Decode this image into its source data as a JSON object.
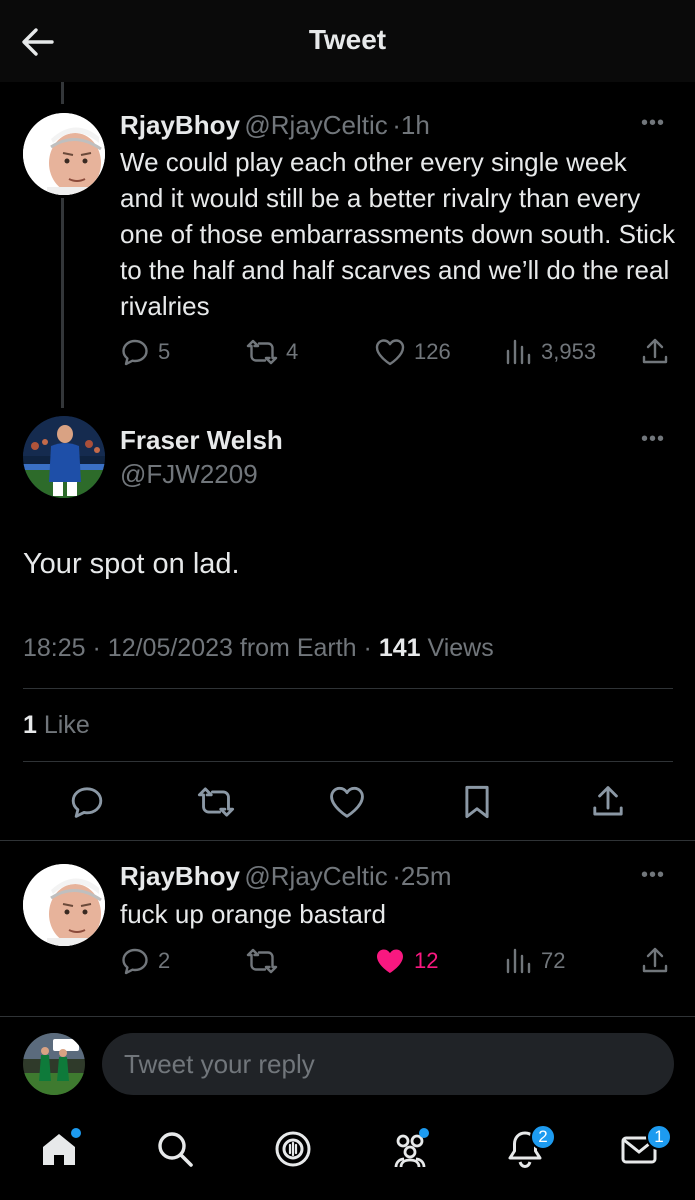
{
  "header": {
    "title": "Tweet"
  },
  "parent_tweet": {
    "name": "RjayBhoy",
    "handle": "@RjayCeltic",
    "time": "1h",
    "text": "We could play each other every single week and it would still be a better rivalry than every one of those embarrassments down south. Stick to the half and half scarves and we’ll do the real rivalries",
    "replies": "5",
    "retweets": "4",
    "likes": "126",
    "views": "3,953"
  },
  "main_tweet": {
    "name": "Fraser Welsh",
    "handle": "@FJW2209",
    "text": "Your spot on lad.",
    "time": "18:25",
    "date": "12/05/2023",
    "source": "from Earth",
    "views_count": "141",
    "views_label": "Views",
    "likes_count": "1",
    "likes_label": "Like"
  },
  "reply_tweet": {
    "name": "RjayBhoy",
    "handle": "@RjayCeltic",
    "time": "25m",
    "text": "fuck up orange bastard",
    "replies": "2",
    "likes": "12",
    "views": "72"
  },
  "composer": {
    "placeholder": "Tweet your reply"
  },
  "nav": {
    "notifications_badge": "2",
    "messages_badge": "1"
  },
  "colors": {
    "background": "#000000",
    "accent": "#1d9bf0",
    "like": "#f91880",
    "muted": "#71767b"
  }
}
